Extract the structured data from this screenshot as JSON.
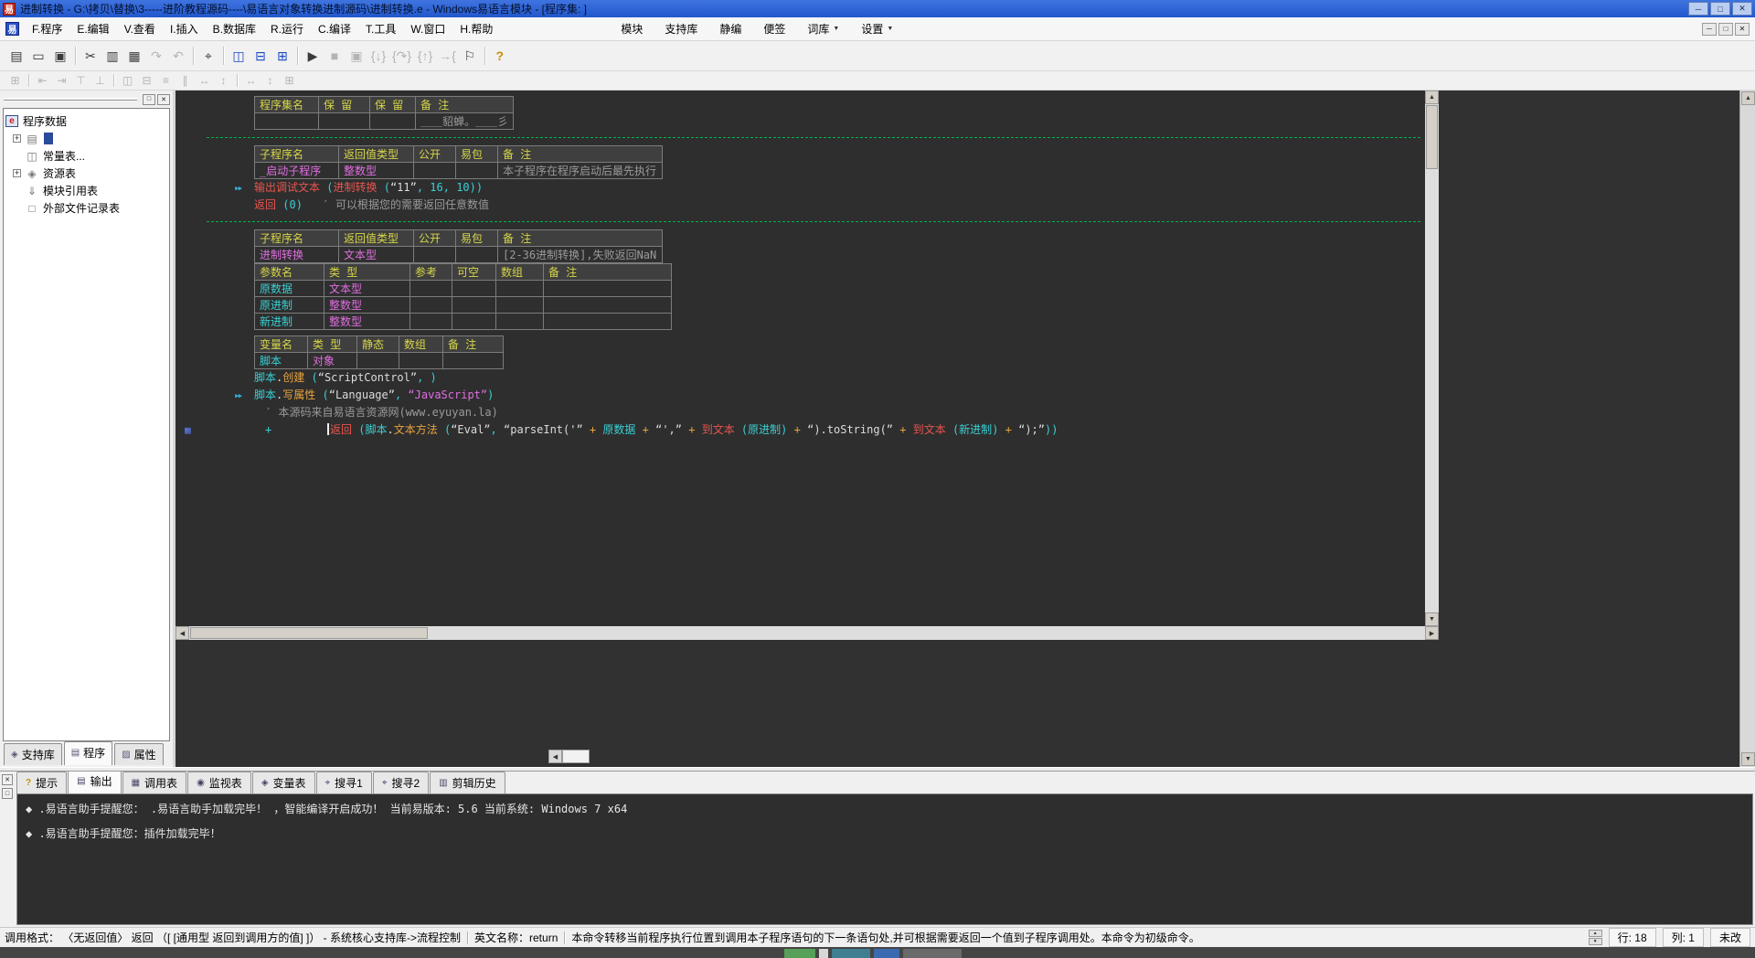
{
  "window": {
    "title": "进制转换 - G:\\拷贝\\替换\\3-----进阶教程源码----\\易语言对象转换进制源码\\进制转换.e - Windows易语言模块 - [程序集: ]",
    "app_icon": "易",
    "controls": {
      "minimize": "─",
      "maximize": "□",
      "close": "✕"
    }
  },
  "menu": {
    "items": [
      {
        "id": "program",
        "label": "F.程序"
      },
      {
        "id": "edit",
        "label": "E.编辑"
      },
      {
        "id": "view",
        "label": "V.查看"
      },
      {
        "id": "insert",
        "label": "I.插入"
      },
      {
        "id": "database",
        "label": "B.数据库"
      },
      {
        "id": "run",
        "label": "R.运行"
      },
      {
        "id": "compile",
        "label": "C.编译"
      },
      {
        "id": "tools",
        "label": "T.工具"
      },
      {
        "id": "window",
        "label": "W.窗口"
      },
      {
        "id": "help",
        "label": "H.帮助"
      }
    ],
    "right_items": [
      {
        "id": "module",
        "label": "模块"
      },
      {
        "id": "support-lib",
        "label": "支持库"
      },
      {
        "id": "static-compile",
        "label": "静编"
      },
      {
        "id": "note",
        "label": "便签"
      },
      {
        "id": "lexicon",
        "label": "词库",
        "dropdown": true
      },
      {
        "id": "settings",
        "label": "设置",
        "dropdown": true
      }
    ],
    "mdi_controls": {
      "minimize": "─",
      "restore": "□",
      "close": "✕"
    }
  },
  "toolbars": {
    "main": [
      {
        "name": "new-file",
        "glyph": "▤"
      },
      {
        "name": "open-file",
        "glyph": "▭"
      },
      {
        "name": "save",
        "glyph": "▣"
      },
      {
        "sep": true
      },
      {
        "name": "cut",
        "glyph": "✂"
      },
      {
        "name": "copy",
        "glyph": "▥"
      },
      {
        "name": "paste",
        "glyph": "▦"
      },
      {
        "name": "redo",
        "glyph": "↷",
        "enabled": false
      },
      {
        "name": "undo",
        "glyph": "↶",
        "enabled": false
      },
      {
        "sep": true
      },
      {
        "name": "find",
        "glyph": "⌖"
      },
      {
        "sep": true
      },
      {
        "name": "layout-left",
        "glyph": "◫",
        "accent": true
      },
      {
        "name": "layout-top",
        "glyph": "⊟",
        "accent": true
      },
      {
        "name": "layout-grid",
        "glyph": "⊞",
        "accent": true
      },
      {
        "sep": true
      },
      {
        "name": "run",
        "glyph": "▶"
      },
      {
        "name": "stop",
        "glyph": "■",
        "enabled": false
      },
      {
        "name": "debug-run",
        "glyph": "▣",
        "enabled": false
      },
      {
        "name": "step-into",
        "glyph": "{↓}",
        "enabled": false
      },
      {
        "name": "step-over",
        "glyph": "{↷}",
        "enabled": false
      },
      {
        "name": "step-out",
        "glyph": "{↑}",
        "enabled": false
      },
      {
        "name": "run-to-cursor",
        "glyph": "→{",
        "enabled": false
      },
      {
        "name": "pause",
        "glyph": "⚐"
      },
      {
        "sep": true
      },
      {
        "name": "help-find",
        "glyph": "?",
        "gold": true
      }
    ],
    "form": [
      {
        "name": "form-designer",
        "glyph": "⊞",
        "enabled": false
      },
      {
        "sep": true
      },
      {
        "name": "align-left",
        "glyph": "⇤",
        "enabled": false
      },
      {
        "name": "align-right",
        "glyph": "⇥",
        "enabled": false
      },
      {
        "name": "align-top",
        "glyph": "⊤",
        "enabled": false
      },
      {
        "name": "align-bottom",
        "glyph": "⊥",
        "enabled": false
      },
      {
        "sep": true
      },
      {
        "name": "center-horizontal",
        "glyph": "◫",
        "enabled": false
      },
      {
        "name": "center-vertical",
        "glyph": "⊟",
        "enabled": false
      },
      {
        "name": "space-equal-horizontal",
        "glyph": "≡",
        "enabled": false
      },
      {
        "name": "space-equal-vertical",
        "glyph": "∥",
        "enabled": false
      },
      {
        "name": "expand-width",
        "glyph": "↔",
        "enabled": false
      },
      {
        "name": "expand-height",
        "glyph": "↕",
        "enabled": false
      },
      {
        "sep": true
      },
      {
        "name": "same-width",
        "glyph": "↔",
        "enabled": false
      },
      {
        "name": "same-height",
        "glyph": "↕",
        "enabled": false
      },
      {
        "name": "same-size",
        "glyph": "⊞",
        "enabled": false
      }
    ]
  },
  "sidebar": {
    "tree": {
      "root": "程序数据",
      "items": [
        {
          "id": "assembly",
          "glyph": "▤",
          "label": "",
          "expandable": true,
          "selected": true
        },
        {
          "id": "constants",
          "glyph": "◫",
          "label": "常量表..."
        },
        {
          "id": "resources",
          "glyph": "◈",
          "label": "资源表",
          "expandable": true
        },
        {
          "id": "module-refs",
          "glyph": "⇓",
          "label": "模块引用表"
        },
        {
          "id": "external-files",
          "glyph": "□",
          "label": "外部文件记录表"
        }
      ]
    },
    "tabs": [
      {
        "id": "support-lib",
        "glyph": "◈",
        "label": "支持库"
      },
      {
        "id": "program",
        "glyph": "▤",
        "label": "程序",
        "active": true
      },
      {
        "id": "properties",
        "glyph": "▨",
        "label": "属性"
      }
    ]
  },
  "editor": {
    "blocks": [
      {
        "type": "table",
        "kind": "assembly",
        "name": "assembly-table",
        "headers": [
          "程序集名",
          "保 留",
          "保 留",
          "备 注"
        ],
        "rows": [
          [
            {
              "t": ""
            },
            {
              "t": ""
            },
            {
              "t": ""
            },
            {
              "t": "＿＿貂蝉。＿＿彡",
              "c": "gray"
            }
          ]
        ]
      },
      {
        "type": "dash"
      },
      {
        "type": "table",
        "kind": "sub",
        "name": "subroutine-table-startup",
        "headers": [
          "子程序名",
          "返回值类型",
          "公开",
          "易包",
          "备 注"
        ],
        "rows": [
          [
            {
              "t": "_启动子程序",
              "c": "mag"
            },
            {
              "t": "整数型",
              "c": "mag"
            },
            {
              "t": ""
            },
            {
              "t": ""
            },
            {
              "t": "本子程序在程序启动后最先执行",
              "c": "gray"
            }
          ]
        ]
      },
      {
        "type": "code",
        "lines": [
          {
            "marker": "exec",
            "tokens": [
              {
                "t": "输出调试文本 ",
                "c": "kw"
              },
              {
                "t": "(",
                "c": "cy"
              },
              {
                "t": "进制转换 ",
                "c": "kw"
              },
              {
                "t": "(",
                "c": "cy"
              },
              {
                "t": "“11”",
                "c": "str"
              },
              {
                "t": ", ",
                "c": "cy"
              },
              {
                "t": "16",
                "c": "cy"
              },
              {
                "t": ", ",
                "c": "cy"
              },
              {
                "t": "10",
                "c": "cy"
              },
              {
                "t": "))",
                "c": "cy"
              }
            ]
          },
          {
            "tokens": [
              {
                "t": "返回 ",
                "c": "kw"
              },
              {
                "t": "(",
                "c": "cy"
              },
              {
                "t": "0",
                "c": "cy"
              },
              {
                "t": ")",
                "c": "cy"
              },
              {
                "t": "   ′ 可以根据您的需要返回任意数值",
                "c": "cmt"
              }
            ]
          }
        ]
      },
      {
        "type": "dash"
      },
      {
        "type": "table",
        "kind": "sub",
        "name": "subroutine-table-convert",
        "headers": [
          "子程序名",
          "返回值类型",
          "公开",
          "易包",
          "备 注"
        ],
        "rows": [
          [
            {
              "t": "进制转换",
              "c": "mag"
            },
            {
              "t": "文本型",
              "c": "mag"
            },
            {
              "t": ""
            },
            {
              "t": ""
            },
            {
              "t": "[2-36进制转换],失败返回NaN",
              "c": "gray"
            }
          ]
        ]
      },
      {
        "type": "table",
        "kind": "param",
        "name": "parameter-table",
        "headers": [
          "参数名",
          "类 型",
          "参考",
          "可空",
          "数组",
          "备 注"
        ],
        "rows": [
          [
            {
              "t": "原数据",
              "c": "cyan"
            },
            {
              "t": "文本型",
              "c": "mag"
            },
            {
              "t": ""
            },
            {
              "t": ""
            },
            {
              "t": ""
            },
            {
              "t": ""
            }
          ],
          [
            {
              "t": "原进制",
              "c": "cyan"
            },
            {
              "t": "整数型",
              "c": "mag"
            },
            {
              "t": ""
            },
            {
              "t": ""
            },
            {
              "t": ""
            },
            {
              "t": ""
            }
          ],
          [
            {
              "t": "新进制",
              "c": "cyan"
            },
            {
              "t": "整数型",
              "c": "mag"
            },
            {
              "t": ""
            },
            {
              "t": ""
            },
            {
              "t": ""
            },
            {
              "t": ""
            }
          ]
        ]
      },
      {
        "type": "gap",
        "h": 6
      },
      {
        "type": "table",
        "kind": "var",
        "name": "local-variable-table",
        "headers": [
          "变量名",
          "类 型",
          "静态",
          "数组",
          "备 注"
        ],
        "rows": [
          [
            {
              "t": "脚本",
              "c": "cyan"
            },
            {
              "t": "对象",
              "c": "mag"
            },
            {
              "t": ""
            },
            {
              "t": ""
            },
            {
              "t": ""
            }
          ]
        ]
      },
      {
        "type": "code",
        "lines": [
          {
            "tokens": [
              {
                "t": "脚本",
                "c": "cy"
              },
              {
                "t": ".",
                "c": "wh"
              },
              {
                "t": "创建 ",
                "c": "mth"
              },
              {
                "t": "(",
                "c": "cy"
              },
              {
                "t": "“ScriptControl”",
                "c": "str"
              },
              {
                "t": ", ",
                "c": "cy"
              },
              {
                "t": ")",
                "c": "cy"
              }
            ]
          },
          {
            "marker": "exec",
            "tokens": [
              {
                "t": "脚本",
                "c": "cy"
              },
              {
                "t": ".",
                "c": "wh"
              },
              {
                "t": "写属性 ",
                "c": "mth"
              },
              {
                "t": "(",
                "c": "cy"
              },
              {
                "t": "“Language”",
                "c": "str"
              },
              {
                "t": ", ",
                "c": "cy"
              },
              {
                "t": "“JavaScript”",
                "c": "pink"
              },
              {
                "t": ")",
                "c": "cy"
              }
            ]
          },
          {
            "indent": 12,
            "tokens": [
              {
                "t": "′ 本源码来自易语言资源网(www.eyuyan.la)",
                "c": "cmt"
              }
            ]
          },
          {
            "marker": "fold",
            "caret": true,
            "indent": 80,
            "tokens": [
              {
                "t": "返回 ",
                "c": "kw"
              },
              {
                "t": "(",
                "c": "cy"
              },
              {
                "t": "脚本",
                "c": "cy"
              },
              {
                "t": ".",
                "c": "wh"
              },
              {
                "t": "文本方法 ",
                "c": "mth"
              },
              {
                "t": "(",
                "c": "cy"
              },
              {
                "t": "“Eval”",
                "c": "str"
              },
              {
                "t": ", ",
                "c": "cy"
              },
              {
                "t": "“parseInt('”",
                "c": "str"
              },
              {
                "t": " + ",
                "c": "op"
              },
              {
                "t": "原数据",
                "c": "cy"
              },
              {
                "t": " + ",
                "c": "op"
              },
              {
                "t": "“',”",
                "c": "str"
              },
              {
                "t": " + ",
                "c": "op"
              },
              {
                "t": "到文本 ",
                "c": "kw"
              },
              {
                "t": "(",
                "c": "cy"
              },
              {
                "t": "原进制",
                "c": "cy"
              },
              {
                "t": ")",
                "c": "cy"
              },
              {
                "t": " + ",
                "c": "op"
              },
              {
                "t": "“).toString(”",
                "c": "str"
              },
              {
                "t": " + ",
                "c": "op"
              },
              {
                "t": "到文本 ",
                "c": "kw"
              },
              {
                "t": "(",
                "c": "cy"
              },
              {
                "t": "新进制",
                "c": "cy"
              },
              {
                "t": ")",
                "c": "cy"
              },
              {
                "t": " + ",
                "c": "op"
              },
              {
                "t": "“);”",
                "c": "str"
              },
              {
                "t": "))",
                "c": "cy"
              }
            ]
          }
        ]
      }
    ]
  },
  "bottom_panel": {
    "tabs": [
      {
        "id": "hint",
        "glyph": "?",
        "gold": true,
        "label": "提示"
      },
      {
        "id": "output",
        "glyph": "▤",
        "label": "输出",
        "active": true
      },
      {
        "id": "call-table",
        "glyph": "▦",
        "label": "调用表"
      },
      {
        "id": "watch-table",
        "glyph": "◉",
        "label": "监视表"
      },
      {
        "id": "variable-table",
        "glyph": "◈",
        "label": "变量表"
      },
      {
        "id": "search1",
        "glyph": "⌖",
        "label": "搜寻1"
      },
      {
        "id": "search2",
        "glyph": "⌖",
        "label": "搜寻2"
      },
      {
        "id": "clip-history",
        "glyph": "▥",
        "label": "剪辑历史"
      }
    ],
    "output_lines": [
      "◆ .易语言助手提醒您： .易语言助手加载完毕！ ，智能编译开启成功！  当前易版本: 5.6   当前系统: Windows 7 x64",
      "◆ .易语言助手提醒您：插件加载完毕！"
    ]
  },
  "statusbar": {
    "call_format": "调用格式： 〈无返回值〉 返回 （[ [通用型 返回到调用方的值] ]） - 系统核心支持库->流程控制",
    "english_name": "英文名称：return",
    "description": "本命令转移当前程序执行位置到调用本子程序语句的下一条语句处,并可根据需要返回一个值到子程序调用处。本命令为初级命令。",
    "line_label": "行: 18",
    "col_label": "列: 1",
    "modified": "未改"
  }
}
